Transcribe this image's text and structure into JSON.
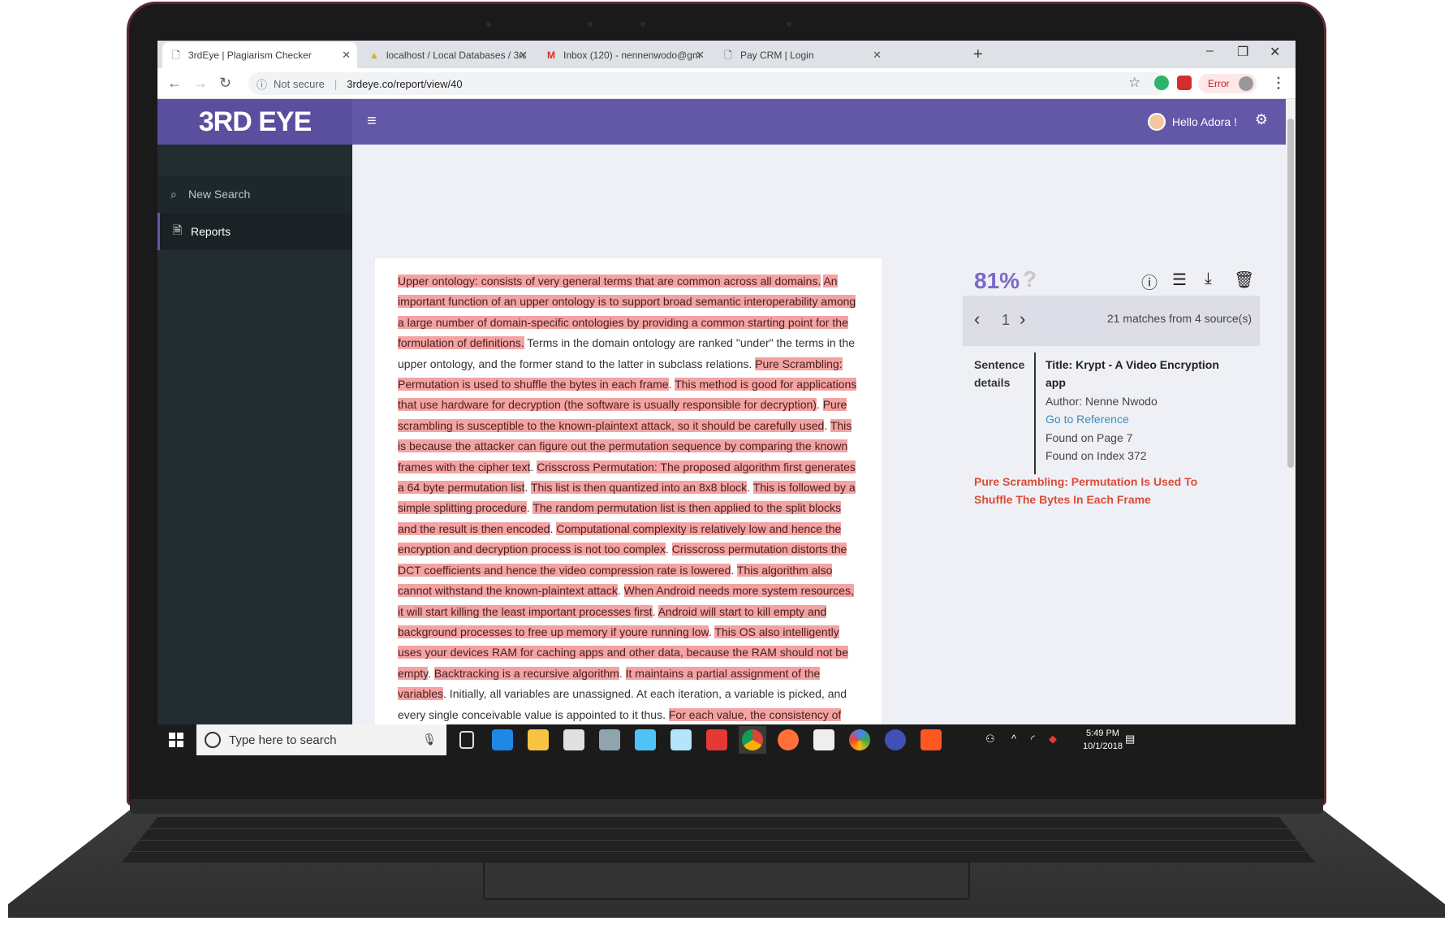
{
  "browser": {
    "tabs": [
      {
        "label": "3rdEye | Plagiarism Checker",
        "icon": "document-icon"
      },
      {
        "label": "localhost / Local Databases / 3rd",
        "icon": "phpmyadmin-icon"
      },
      {
        "label": "Inbox (120) - nennenwodo@gm",
        "icon": "gmail-icon"
      },
      {
        "label": "Pay CRM | Login",
        "icon": "document-icon"
      }
    ],
    "security_label": "Not secure",
    "url": "3rdeye.co/report/view/40",
    "error_label": "Error"
  },
  "app": {
    "logo": "3RD EYE",
    "greeting": "Hello Adora !",
    "sidebar": [
      {
        "label": "New Search",
        "icon": "search-icon"
      },
      {
        "label": "Reports",
        "icon": "document-icon"
      }
    ],
    "colors": {
      "nav": "#6357a8",
      "sidebar": "#222d32",
      "highlight": "#f4a3a3",
      "accent_red": "#dd4b39",
      "percent": "#7b68c8"
    }
  },
  "document": {
    "segments": [
      {
        "text": "Upper ontology: consists of very general terms that are common across all domains.",
        "hl": true
      },
      {
        "text": " ",
        "hl": false
      },
      {
        "text": "An important function of an upper ontology is to support broad semantic interoperability among a large number of domain-specific ontologies by providing a common starting point for the formulation of definitions.",
        "hl": true
      },
      {
        "text": " Terms in the domain ontology are ranked \"under\" the terms in the upper ontology, and the former stand to the latter in subclass relations. ",
        "hl": false
      },
      {
        "text": "Pure Scrambling: Permutation is used to shuffle the bytes in each frame",
        "hl": true
      },
      {
        "text": ". ",
        "hl": false
      },
      {
        "text": "This method is good for applications that use hardware for decryption (the software is usually responsible for decryption)",
        "hl": true
      },
      {
        "text": ". ",
        "hl": false
      },
      {
        "text": "Pure scrambling is susceptible to the known-plaintext attack, so it should be carefully used",
        "hl": true
      },
      {
        "text": ". ",
        "hl": false
      },
      {
        "text": "This is because the attacker can figure out the permutation sequence by comparing the known frames with the cipher text",
        "hl": true
      },
      {
        "text": ". ",
        "hl": false
      },
      {
        "text": "Crisscross Permutation: The proposed algorithm first generates a 64 byte permutation list",
        "hl": true
      },
      {
        "text": ". ",
        "hl": false
      },
      {
        "text": "This list is then quantized into an 8x8 block",
        "hl": true
      },
      {
        "text": ". ",
        "hl": false
      },
      {
        "text": "This is followed by a simple splitting procedure",
        "hl": true
      },
      {
        "text": ". ",
        "hl": false
      },
      {
        "text": "The random permutation list is then applied to the split blocks and the result is then encoded",
        "hl": true
      },
      {
        "text": ". ",
        "hl": false
      },
      {
        "text": "Computational complexity is relatively low and hence the encryption and decryption process is not too complex",
        "hl": true
      },
      {
        "text": ". ",
        "hl": false
      },
      {
        "text": "Crisscross permutation distorts the DCT coefficients and hence the video compression rate is lowered",
        "hl": true
      },
      {
        "text": ". ",
        "hl": false
      },
      {
        "text": "This algorithm also cannot withstand the known-plaintext attack",
        "hl": true
      },
      {
        "text": ". ",
        "hl": false
      },
      {
        "text": "When Android needs more system resources, it will start killing the least important processes first",
        "hl": true
      },
      {
        "text": ". ",
        "hl": false
      },
      {
        "text": "Android will start to kill empty and background processes to free up memory if youre running low",
        "hl": true
      },
      {
        "text": ". ",
        "hl": false
      },
      {
        "text": "This OS also intelligently uses your devices RAM for caching apps and other data, because the RAM should not be empty",
        "hl": true
      },
      {
        "text": ". ",
        "hl": false
      },
      {
        "text": "Backtracking is a recursive algorithm",
        "hl": true
      },
      {
        "text": ". ",
        "hl": false
      },
      {
        "text": "It maintains a partial assignment of the variables",
        "hl": true
      },
      {
        "text": ". Initially, all variables are unassigned. At each iteration, a variable is picked, and every single conceivable value is appointed to it thus. ",
        "hl": false
      },
      {
        "text": "For each value, the consistency of the partial assignment with the constraints is checked; if there should arise an occurrence of consistency, a recursive call is performed Constraint propagation techniques are techniques used to",
        "hl": true
      }
    ]
  },
  "report": {
    "percent": "81%",
    "help_glyph": "?",
    "page": "1",
    "matches": "21 matches from 4 source(s)",
    "sentence_label": "Sentence details",
    "title": "Title: Krypt - A Video Encryption app",
    "author": "Author: Nenne Nwodo",
    "reference_link": "Go to Reference",
    "found_page": "Found on Page 7",
    "found_index": "Found on Index 372",
    "matched_sentence": "Pure Scrambling: Permutation Is Used To Shuffle The Bytes In Each Frame"
  },
  "taskbar": {
    "search_placeholder": "Type here to search",
    "time": "5:49 PM",
    "date": "10/1/2018"
  }
}
